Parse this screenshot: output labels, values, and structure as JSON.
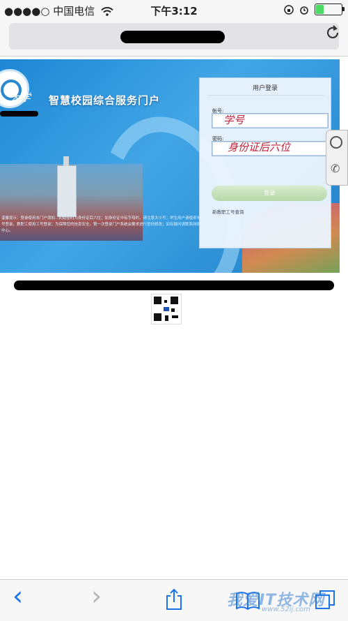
{
  "status_bar": {
    "signal": "●●●●○",
    "carrier": "中国电信",
    "wifi_icon": "wifi-icon",
    "time": "下午3:12",
    "battery_level_pct": 30
  },
  "browser": {
    "address_redacted": true,
    "reload_icon": "reload-icon"
  },
  "banner": {
    "university_name": "大学",
    "portal_title": "智慧校园综合服务门户",
    "notice_text": "温馨提示：登录使用本门户须知…初始密码为身份证后六位；如身份证中有字母的，请注意大小写；学生用户请使用学号登录，教职工使用工号登录；为保障您的信息安全，第一次登录门户系统会要求进行密码修改；如有疑问请联系网络中心。"
  },
  "login_panel": {
    "heading": "用户登录",
    "account_label": "帐号:",
    "account_value": "学号",
    "password_label": "密码:",
    "password_value": "身份证后六位",
    "login_button": "登录",
    "new_staff_link": "新教职工号查询"
  },
  "side_widget": {
    "service_icon": "customer-service-icon",
    "phone_icon": "phone-icon"
  },
  "toolbar": {
    "back": "‹",
    "forward": "›",
    "share_icon": "share-icon",
    "bookmarks_icon": "bookmarks-icon",
    "tabs_icon": "tabs-icon"
  },
  "watermark": {
    "text": "我爱IT技术网",
    "sub": "www.52ij.com"
  },
  "colors": {
    "banner_blue": "#2a8fd8",
    "ios_blue": "#1a73e8",
    "handwriting_red": "#c3203a",
    "button_green": "#b6d7a8"
  }
}
